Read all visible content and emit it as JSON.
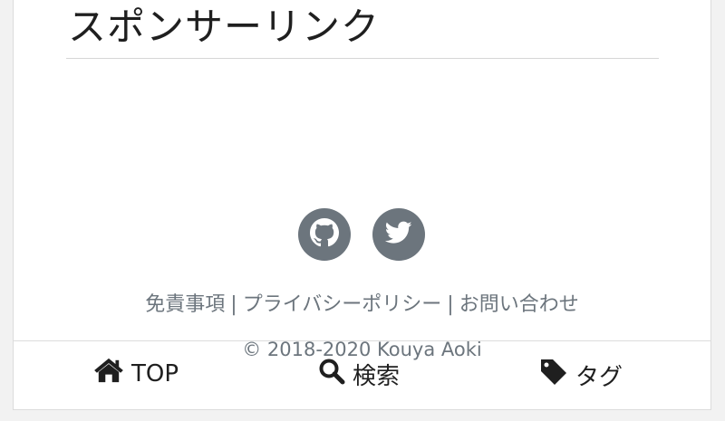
{
  "heading": "スポンサーリンク",
  "social": {
    "github_icon": "github-icon",
    "twitter_icon": "twitter-icon",
    "color": "#6c757d"
  },
  "footer": {
    "links": [
      "免責事項",
      "プライバシーポリシー",
      "お問い合わせ"
    ],
    "separator": "|",
    "copyright": "© 2018-2020 Kouya Aoki"
  },
  "bottom_nav": {
    "items": [
      {
        "label": "TOP",
        "icon": "home-icon"
      },
      {
        "label": "検索",
        "icon": "search-icon"
      },
      {
        "label": "タグ",
        "icon": "tag-icon"
      }
    ]
  }
}
